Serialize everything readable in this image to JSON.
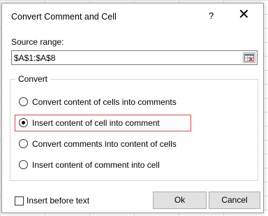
{
  "dialog": {
    "title": "Convert Comment and Cell",
    "help_label": "?",
    "close_label": "✕"
  },
  "source": {
    "label": "Source range:",
    "value": "$A$1:$A$8"
  },
  "convert": {
    "legend": "Convert",
    "options": [
      {
        "label": "Convert content of cells into comments",
        "selected": false
      },
      {
        "label": "Insert content of cell into comment",
        "selected": true
      },
      {
        "label": "Convert comments into content of cells",
        "selected": false
      },
      {
        "label": "Insert content of comment into cell",
        "selected": false
      }
    ],
    "highlight_color": "#e0453a"
  },
  "insert_before_text": {
    "label": "Insert before text",
    "checked": false
  },
  "buttons": {
    "ok_label": "Ok",
    "cancel_label": "Cancel"
  }
}
